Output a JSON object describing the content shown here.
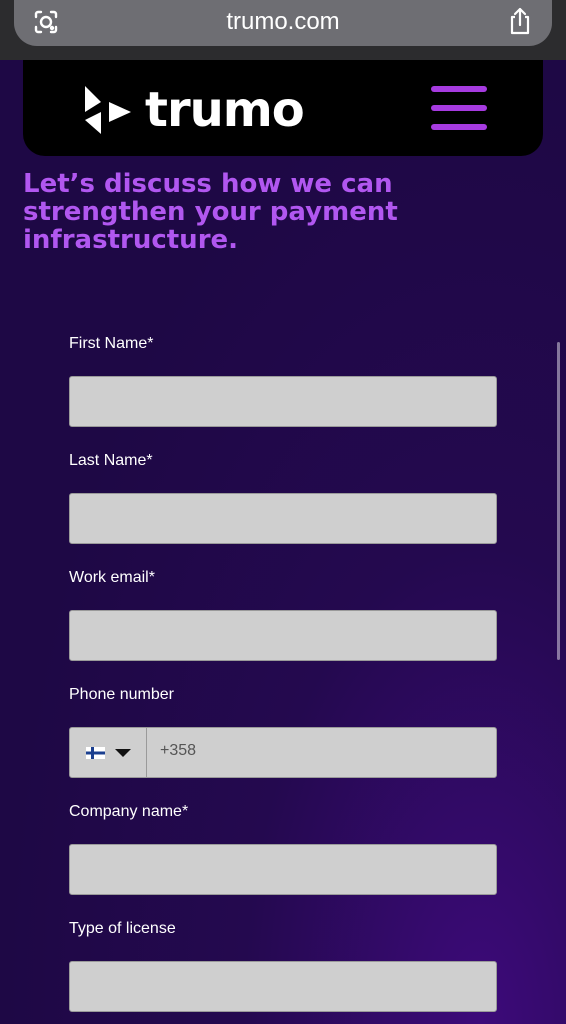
{
  "browser": {
    "url": "trumo.com",
    "icons": [
      "lens-icon",
      "share-icon"
    ]
  },
  "header": {
    "brand": "trumo",
    "menu_icon": "hamburger-menu-icon"
  },
  "headline": "Let’s discuss how we can strengthen your payment infrastructure.",
  "form": {
    "first_name_label": "First Name*",
    "last_name_label": "Last Name*",
    "work_email_label": "Work email*",
    "phone_label": "Phone number",
    "phone_prefix": "+358",
    "phone_country": "Finland",
    "company_label": "Company name*",
    "license_label": "Type of license"
  },
  "colors": {
    "accent": "#b157f0",
    "menu": "#a63be0",
    "background": "#1e0845",
    "input_bg": "#cfcfcf"
  }
}
